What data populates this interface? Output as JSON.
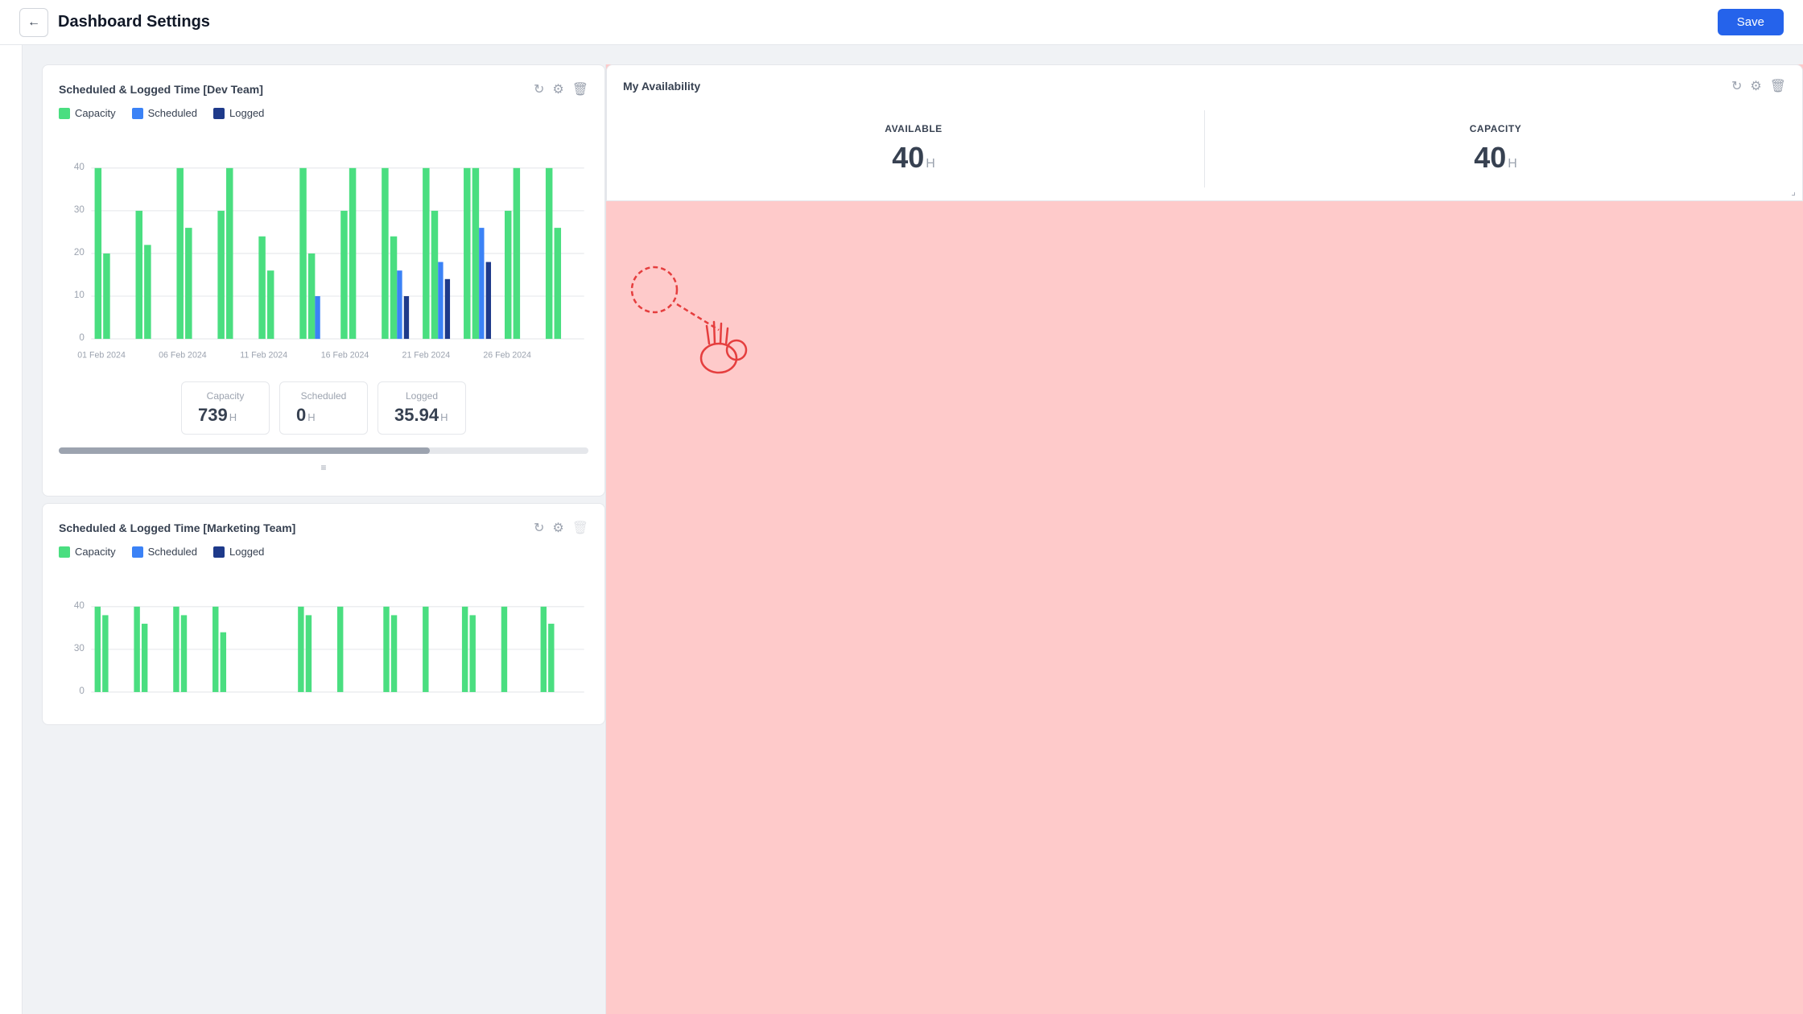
{
  "header": {
    "title": "Dashboard Settings",
    "save_label": "Save",
    "back_icon": "←"
  },
  "chart1": {
    "title": "Scheduled & Logged Time [Dev Team]",
    "legend": [
      {
        "key": "capacity",
        "label": "Capacity",
        "color_class": "dot-capacity"
      },
      {
        "key": "scheduled",
        "label": "Scheduled",
        "color_class": "dot-scheduled"
      },
      {
        "key": "logged",
        "label": "Logged",
        "color_class": "dot-logged"
      }
    ],
    "x_labels": [
      "01 Feb 2024",
      "06 Feb 2024",
      "11 Feb 2024",
      "16 Feb 2024",
      "21 Feb 2024",
      "26 Feb 2024"
    ],
    "y_labels": [
      "0",
      "10",
      "20",
      "30",
      "40"
    ],
    "stats": [
      {
        "label": "Capacity",
        "value": "739",
        "unit": "H"
      },
      {
        "label": "Scheduled",
        "value": "0",
        "unit": "H"
      },
      {
        "label": "Logged",
        "value": "35.94",
        "unit": "H"
      }
    ]
  },
  "chart2": {
    "title": "Scheduled & Logged Time [Marketing Team]",
    "legend": [
      {
        "key": "capacity",
        "label": "Capacity",
        "color_class": "dot-capacity"
      },
      {
        "key": "scheduled",
        "label": "Scheduled",
        "color_class": "dot-scheduled"
      },
      {
        "key": "logged",
        "label": "Logged",
        "color_class": "dot-logged"
      }
    ]
  },
  "availability": {
    "title": "My Availability",
    "stats": [
      {
        "label": "AVAILABLE",
        "value": "40",
        "unit": "H"
      },
      {
        "label": "CAPACITY",
        "value": "40",
        "unit": "H"
      }
    ]
  },
  "icons": {
    "refresh": "↻",
    "settings": "⚙",
    "delete": "🗑",
    "resize": "≡"
  }
}
